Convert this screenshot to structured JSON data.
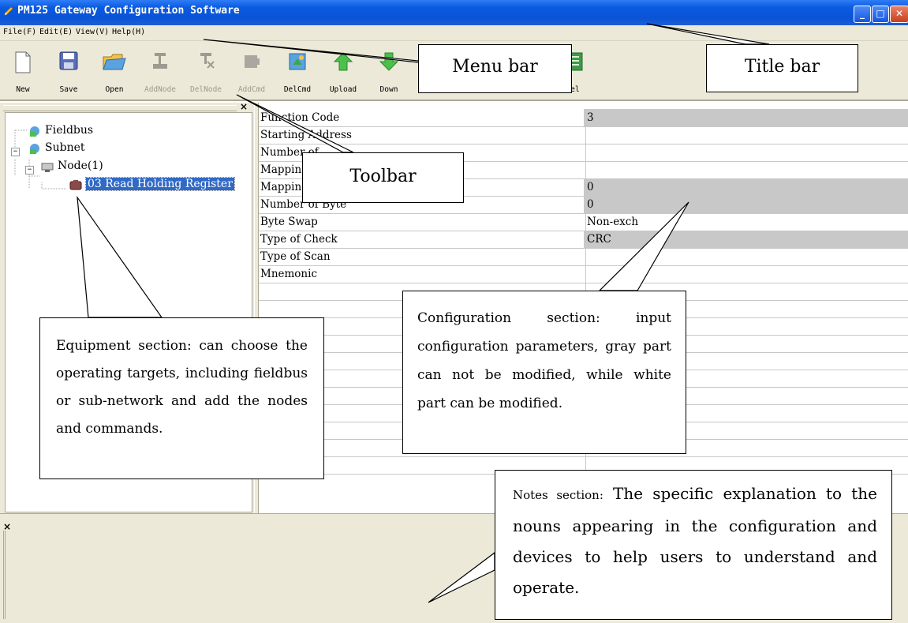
{
  "window": {
    "title": "PM125 Gateway Configuration Software",
    "controls": [
      "minimize",
      "maximize",
      "close"
    ]
  },
  "menu": [
    "File(F)",
    "Edit(E)",
    "View(V)",
    "Help(H)"
  ],
  "toolbar": [
    {
      "label": "New",
      "icon": "new-file-icon",
      "enabled": true
    },
    {
      "label": "Save",
      "icon": "save-icon",
      "enabled": true
    },
    {
      "label": "Open",
      "icon": "open-folder-icon",
      "enabled": true
    },
    {
      "label": "AddNode",
      "icon": "add-node-icon",
      "enabled": false
    },
    {
      "label": "DelNode",
      "icon": "delete-node-icon",
      "enabled": false
    },
    {
      "label": "AddCmd",
      "icon": "add-command-icon",
      "enabled": false
    },
    {
      "label": "DelCmd",
      "icon": "delete-command-icon",
      "enabled": true
    },
    {
      "label": "Upload",
      "icon": "upload-icon",
      "enabled": true
    },
    {
      "label": "Down",
      "icon": "download-icon",
      "enabled": true
    },
    {
      "label": "el",
      "icon": "excel-icon",
      "enabled": true
    }
  ],
  "tree": {
    "fieldbus": "Fieldbus",
    "subnet": "Subnet",
    "node": "Node(1)",
    "command": "03 Read Holding Register"
  },
  "properties": [
    {
      "name": "Function Code",
      "value": "3",
      "readonly": true
    },
    {
      "name": "Starting Address",
      "value": "",
      "readonly": false
    },
    {
      "name": "Number of",
      "value": "",
      "readonly": false
    },
    {
      "name": "Mapping",
      "value": "",
      "readonly": false
    },
    {
      "name": "Mapping",
      "value": "0",
      "readonly": true
    },
    {
      "name": "Number of Byte",
      "value": "0",
      "readonly": true
    },
    {
      "name": "Byte Swap",
      "value": "Non-exch",
      "readonly": false
    },
    {
      "name": "Type of Check",
      "value": "CRC",
      "readonly": true
    },
    {
      "name": "Type of Scan",
      "value": "",
      "readonly": false
    },
    {
      "name": "Mnemonic",
      "value": "",
      "readonly": false
    }
  ],
  "empty_rows": 11,
  "callouts": {
    "title_bar": "Title bar",
    "menu_bar": "Menu bar",
    "toolbar": "Toolbar",
    "equipment": "Equipment section: can choose the operating targets, including fieldbus or sub-network and add the nodes and commands.",
    "configuration": "Configuration section: input configuration parameters, gray part can not be modified, while white part can be modified.",
    "notes_prefix": "Notes section:",
    "notes_body": "The specific explanation to the nouns appearing in the configuration and devices to help users to understand and operate."
  },
  "colors": {
    "titlebar": "#0a53d6",
    "chrome": "#ece9d8",
    "selection": "#316ac5",
    "readonly_cell": "#c8c8c8"
  }
}
